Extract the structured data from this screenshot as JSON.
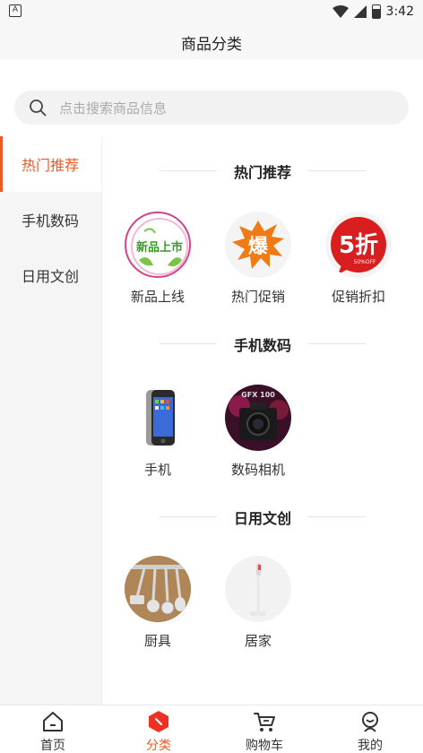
{
  "status_bar": {
    "left_icon": "A",
    "time": "3:42"
  },
  "header": {
    "title": "商品分类"
  },
  "search": {
    "placeholder": "点击搜索商品信息"
  },
  "sidebar": {
    "items": [
      {
        "label": "热门推荐",
        "active": true
      },
      {
        "label": "手机数码",
        "active": false
      },
      {
        "label": "日用文创",
        "active": false
      }
    ]
  },
  "sections": [
    {
      "title": "热门推荐",
      "items": [
        {
          "label": "新品上线",
          "icon": "new-products-icon",
          "icon_text": "新品上市"
        },
        {
          "label": "热门促销",
          "icon": "hot-sale-icon",
          "icon_text": "爆"
        },
        {
          "label": "促销折扣",
          "icon": "discount-icon",
          "icon_text": "5折",
          "icon_subtext": "50%OFF"
        }
      ]
    },
    {
      "title": "手机数码",
      "items": [
        {
          "label": "手机",
          "icon": "phone-icon"
        },
        {
          "label": "数码相机",
          "icon": "camera-icon",
          "icon_text": "GFX 100"
        }
      ]
    },
    {
      "title": "日用文创",
      "items": [
        {
          "label": "厨具",
          "icon": "kitchenware-icon"
        },
        {
          "label": "居家",
          "icon": "home-appliance-icon"
        }
      ]
    }
  ],
  "bottom_nav": {
    "items": [
      {
        "label": "首页",
        "icon": "home-icon",
        "active": false
      },
      {
        "label": "分类",
        "icon": "category-icon",
        "active": true
      },
      {
        "label": "购物车",
        "icon": "cart-icon",
        "active": false
      },
      {
        "label": "我的",
        "icon": "profile-icon",
        "active": false
      }
    ]
  },
  "colors": {
    "accent": "#ee5a24",
    "sidebar_bg": "#f5f5f5",
    "search_bg": "#f2f2f2"
  }
}
